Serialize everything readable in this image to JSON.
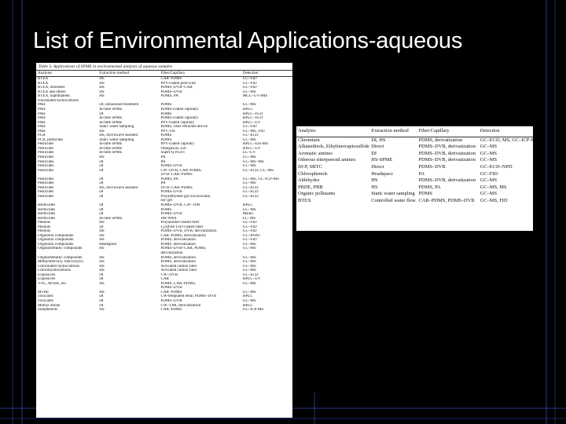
{
  "slide": {
    "title": "List of Environmental Applications-aqueous"
  },
  "left_table": {
    "caption": "Table 3. Applications of SPME in environmental analysis of aqueous samples",
    "headers": [
      "Analytes",
      "Extraction method",
      "Fiber/Capillary",
      "Detection"
    ],
    "rows": [
      [
        "BTEX",
        "HS",
        "CAR–PDMS",
        "GC–FID"
      ],
      [
        "BTEX",
        "HS",
        "PPY-coated gold wire",
        "GC–FID"
      ],
      [
        "BTEX, benzenes",
        "HS",
        "PDMS–DVB–CAR",
        "GC–FID"
      ],
      [
        "BTEX and others",
        "HS",
        "PDMS–DVB",
        "GC–MS"
      ],
      [
        "BTEX, naphthalene,",
        "HS",
        "PDMS, PA",
        "MCC–UV-IMS"
      ],
      [
        "chlorinated hydrocarbons",
        "",
        "",
        ""
      ],
      [
        "PAH",
        "DI, ultrasound treatment",
        "PDMS",
        "GC–MS"
      ],
      [
        "PAH",
        "In-tube SPME",
        "PDMS-coated capillary",
        "HPLC"
      ],
      [
        "PAH",
        "DI",
        "PDMS",
        "HPLC–FLD"
      ],
      [
        "PAH",
        "In-tube SPME",
        "PDMS-coated capillary",
        "HPLC–FLD"
      ],
      [
        "PAH",
        "In-tube SPME",
        "PPY-coated capillary",
        "HPLC–UV"
      ],
      [
        "PAH",
        "Static water sampling",
        "PDMS, fiber retracted device",
        "GC–FID"
      ],
      [
        "PAH",
        "HS",
        "PPY–OS",
        "GC–MS, FID"
      ],
      [
        "PCB",
        "HS, microwave assisted",
        "PDMS",
        "GC–ECD"
      ],
      [
        "PCB, pesticides",
        "Static water sampling",
        "PDMS",
        "GC–MS"
      ],
      [
        "Pesticides",
        "In-tube SPME",
        "PPY-coated capillary",
        "HPLC–ESI-MS"
      ],
      [
        "Pesticides",
        "In-tube SPME",
        "Omegawax 250",
        "HPLC–UV"
      ],
      [
        "Pesticides",
        "In-tube SPME",
        "Supel-Q PLOT",
        "LC–UV"
      ],
      [
        "Pesticides",
        "HS",
        "PA",
        "GC–MS"
      ],
      [
        "Pesticides",
        "DI",
        "PA",
        "GC–MS–MS"
      ],
      [
        "Pesticides",
        "DI",
        "PDMS–DVB",
        "GC–MS"
      ],
      [
        "Pesticides",
        "DI",
        "CW–DVB, CAR–PDMS,",
        "GC–ECD, GC–MS"
      ],
      [
        "",
        "",
        "DVB–CAR–PDMS",
        ""
      ],
      [
        "Pesticides",
        "DI",
        "PDMS, PA",
        "GC–MS, GC–ICP-MS"
      ],
      [
        "Pesticides",
        "DI",
        "PA",
        "GC–MS"
      ],
      [
        "Pesticides",
        "HS, microwave assisted",
        "DVB–CAR–PDMS",
        "GC–ECD"
      ],
      [
        "Pesticides",
        "DI",
        "PDMS–DVB",
        "GC–ECD"
      ],
      [
        "Pesticides",
        "DI",
        "Poly(ethylene glycol)/siloxane,",
        "GC–ECD"
      ],
      [
        "",
        "",
        "sol–gel",
        ""
      ],
      [
        "Herbicides",
        "DI",
        "PDMS–DVB, CW–TPR",
        "HPLC"
      ],
      [
        "Herbicides",
        "DI",
        "PDMS",
        "GC–MS"
      ],
      [
        "Herbicides",
        "DI",
        "PDMS–DVB",
        "MEKC"
      ],
      [
        "Herbicides",
        "In-tube SPME",
        "DB-WAX",
        "LC–MS"
      ],
      [
        "Phenols",
        "HS",
        "Polyaniline-coated fiber",
        "GC–FID"
      ],
      [
        "Phenols",
        "DI",
        "C[4]OH-TSO-coated fiber",
        "GC–FID"
      ],
      [
        "Phenols",
        "HS",
        "PDMS–DVB, DVB, derivatization",
        "GC–FID"
      ],
      [
        "Organotin compounds",
        "HS",
        "CAR–PDMS, derivatization",
        "GC–PFPD"
      ],
      [
        "Organotin compounds",
        "HS",
        "PDMS, derivatization",
        "GC–FID"
      ],
      [
        "Organotin compounds",
        "Headspace",
        "PDMS, derivatization",
        "GC–MS"
      ],
      [
        "Organometallic compounds",
        "HS",
        "PDMS–DVB–CAR, PDMS,",
        "GC–MS"
      ],
      [
        "",
        "",
        "derivatization",
        ""
      ],
      [
        "Organometallic compounds",
        "HS",
        "PDMS, derivatization",
        "GC–MS"
      ],
      [
        "Methylmercury, mercury(II)",
        "HS",
        "PDMS, derivatization",
        "GC–MS"
      ],
      [
        "Chlorinated hydrocarbons",
        "HS",
        "Activated carbon fiber",
        "GC–MS"
      ],
      [
        "Chlorohydrocarbons",
        "HS",
        "Activated carbon fiber",
        "GC–MS"
      ],
      [
        "Explosives",
        "DI",
        "CW–DVB",
        "GC–ECD"
      ],
      [
        "Explosives",
        "DI",
        "CAR",
        "HPLC–UV"
      ],
      [
        "VOC, MTBE, etc.",
        "HS",
        "PDMS, CAR–PDMS,",
        "GC–MS"
      ],
      [
        "",
        "",
        "PDMS–DVB",
        ""
      ],
      [
        "MTBE",
        "HS",
        "CAR–PDMS",
        "GC–MS"
      ],
      [
        "Toxicants",
        "DI",
        "CW-templated resin, PDMS–DVB",
        "HPLC"
      ],
      [
        "Toxicants",
        "DI",
        "PDMS–DVB",
        "GC–MS"
      ],
      [
        "Methyl amine",
        "DI",
        "CW–TPR, derivatization",
        "HPLC"
      ],
      [
        "Iodophenols",
        "HS",
        "CAR–PDMS",
        "GC–ICP-MS"
      ]
    ]
  },
  "right_table": {
    "headers": [
      "Analytes",
      "Extraction method",
      "Fiber/Capillary",
      "Detection"
    ],
    "rows": [
      [
        "Chromium",
        "DI, HS",
        "PDMS, derivatization",
        "GC–ECD, MS, GC–ICP-MS"
      ],
      [
        "Alkanethiols, Ethylmercaptosulfide",
        "Direct",
        "PDMS–DVB, derivatization",
        "GC–MS"
      ],
      [
        "Aromatic amines",
        "DI",
        "PDMS–DVB, derivatization",
        "GC–MS"
      ],
      [
        "Odorous triterpenoid amines",
        "HS-SPME",
        "PDMS–DVB, derivatization",
        "GC–MS"
      ],
      [
        "DCP, MITC",
        "Direct",
        "PDMS–DVB",
        "GC–ECD–NPD"
      ],
      [
        "Chlorophenols",
        "Headspace",
        "PA",
        "GC–FID"
      ],
      [
        "Aldehydes",
        "HS",
        "PDMS–DVB, derivatization",
        "GC–MS"
      ],
      [
        "PBDE, PBB",
        "HS",
        "PDMS, PA",
        "GC–MS, MS"
      ],
      [
        "Organic pollutants",
        "Static water sampling",
        "PDMS",
        "GC–MS"
      ],
      [
        "BTEX",
        "Controlled water flow rate",
        "CAR–PDMS, PDMS–DVB",
        "GC–MS, FID"
      ]
    ]
  },
  "colors": {
    "background": "#000000",
    "title": "#ffffff",
    "frame_line": "#2a3a8c"
  }
}
